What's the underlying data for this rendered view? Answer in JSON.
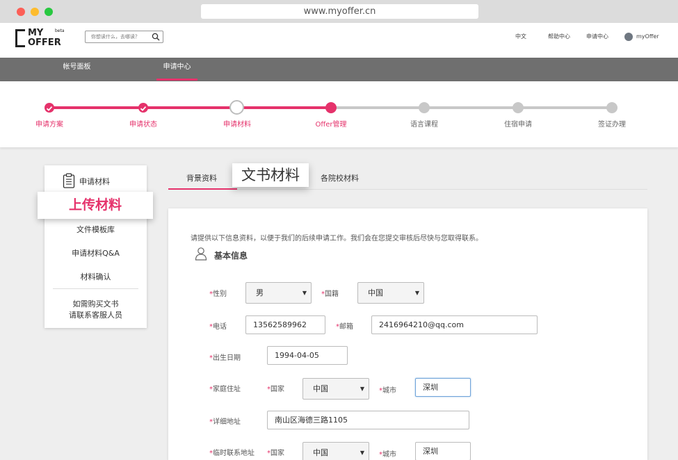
{
  "browser": {
    "url": "www.myoffer.cn"
  },
  "header": {
    "logo_line1": "MY",
    "logo_line2": "OFFER",
    "logo_beta": "beta",
    "search_placeholder": "你想读什么，去哪读？",
    "nav": [
      "中文",
      "帮助中心",
      "申请中心"
    ],
    "user_name": "myOffer"
  },
  "topnav": {
    "tabs": [
      "帐号面板",
      "申请中心"
    ],
    "active": 1
  },
  "progress": {
    "accent": "#e5326b",
    "inactive": "#c8c8c8",
    "steps": [
      {
        "label": "申请方案",
        "state": "done"
      },
      {
        "label": "申请状态",
        "state": "done"
      },
      {
        "label": "申请材料",
        "state": "current"
      },
      {
        "label": "Offer管理",
        "state": "active"
      },
      {
        "label": "语言课程",
        "state": "todo"
      },
      {
        "label": "住宿申请",
        "state": "todo"
      },
      {
        "label": "签证办理",
        "state": "todo"
      }
    ]
  },
  "sidebar": {
    "title": "申请材料",
    "highlight": "上传材料",
    "items": [
      "文件模板库",
      "申请材料Q&A",
      "材料确认"
    ],
    "note_line1": "如需购买文书",
    "note_line2": "请联系客服人员"
  },
  "content_tabs": {
    "tabs": [
      "背景资料",
      "文书材料",
      "各院校材料"
    ],
    "active": 0
  },
  "form": {
    "intro": "请提供以下信息资料，以便于我们的后续申请工作。我们会在您提交审核后尽快与您取得联系。",
    "section_title": "基本信息",
    "required_mark": "*",
    "gender_label": "性别",
    "gender_value": "男",
    "nationality_label": "国籍",
    "nationality_value": "中国",
    "phone_label": "电话",
    "phone_value": "13562589962",
    "email_label": "邮箱",
    "email_value": "2416964210@qq.com",
    "birth_label": "出生日期",
    "birth_value": "1994-04-05",
    "home_label": "家庭住址",
    "country_label": "国家",
    "home_country": "中国",
    "city_label": "城市",
    "home_city": "深圳",
    "detail_label": "详细地址",
    "detail_value": "南山区海德三路1105",
    "temp_label": "临时联系地址",
    "temp_country": "中国",
    "temp_city": "深圳"
  }
}
